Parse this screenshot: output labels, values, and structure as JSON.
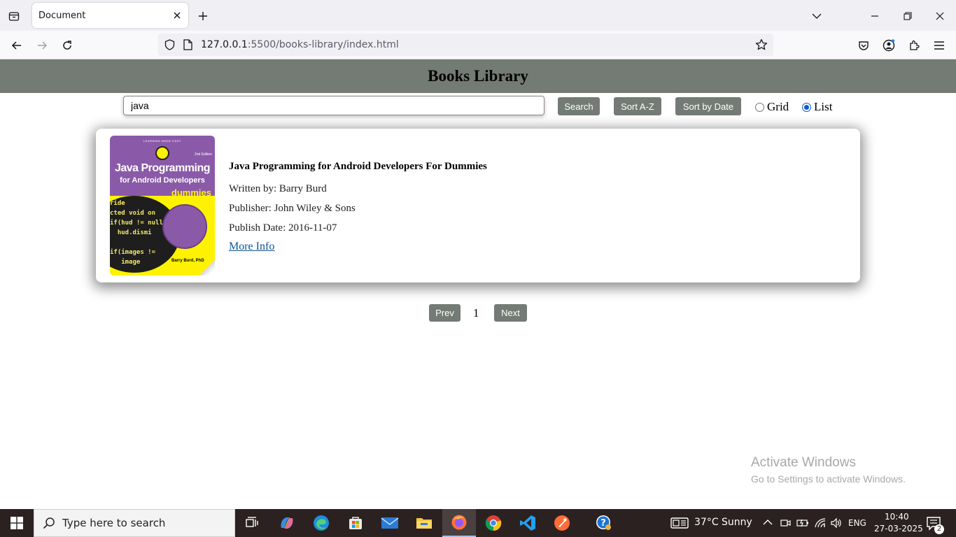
{
  "browser": {
    "tab_title": "Document",
    "url_host": "127.0.0.1",
    "url_rest": ":5500/books-library/index.html"
  },
  "page": {
    "title": "Books Library",
    "search": {
      "value": "java",
      "button": "Search"
    },
    "sort_az": "Sort A-Z",
    "sort_date": "Sort by Date",
    "view_grid": "Grid",
    "view_list": "List",
    "view_selected": "List"
  },
  "books": [
    {
      "title": "Java Programming for Android Developers For Dummies",
      "author_line": "Written by: Barry Burd",
      "publisher_line": "Publisher: John Wiley & Sons",
      "date_line": "Publish Date: 2016-11-07",
      "more_info": "More Info",
      "cover": {
        "series": "LEARNING MADE EASY",
        "edition": "2nd Edition",
        "title": "Java Programming",
        "subtitle": "for Android Developers",
        "brand": "dummies",
        "author": "Barry Burd, PhD"
      }
    }
  ],
  "pagination": {
    "prev": "Prev",
    "current": "1",
    "next": "Next"
  },
  "watermark": {
    "line1": "Activate Windows",
    "line2": "Go to Settings to activate Windows."
  },
  "taskbar": {
    "search_placeholder": "Type here to search",
    "weather": "37°C  Sunny",
    "language": "ENG",
    "time": "10:40",
    "date": "27-03-2025",
    "notification_count": "2"
  },
  "colors": {
    "header_bg": "#737b74",
    "button_bg": "#737b74",
    "link": "#0b5394",
    "radio_accent": "#0b57d0"
  }
}
